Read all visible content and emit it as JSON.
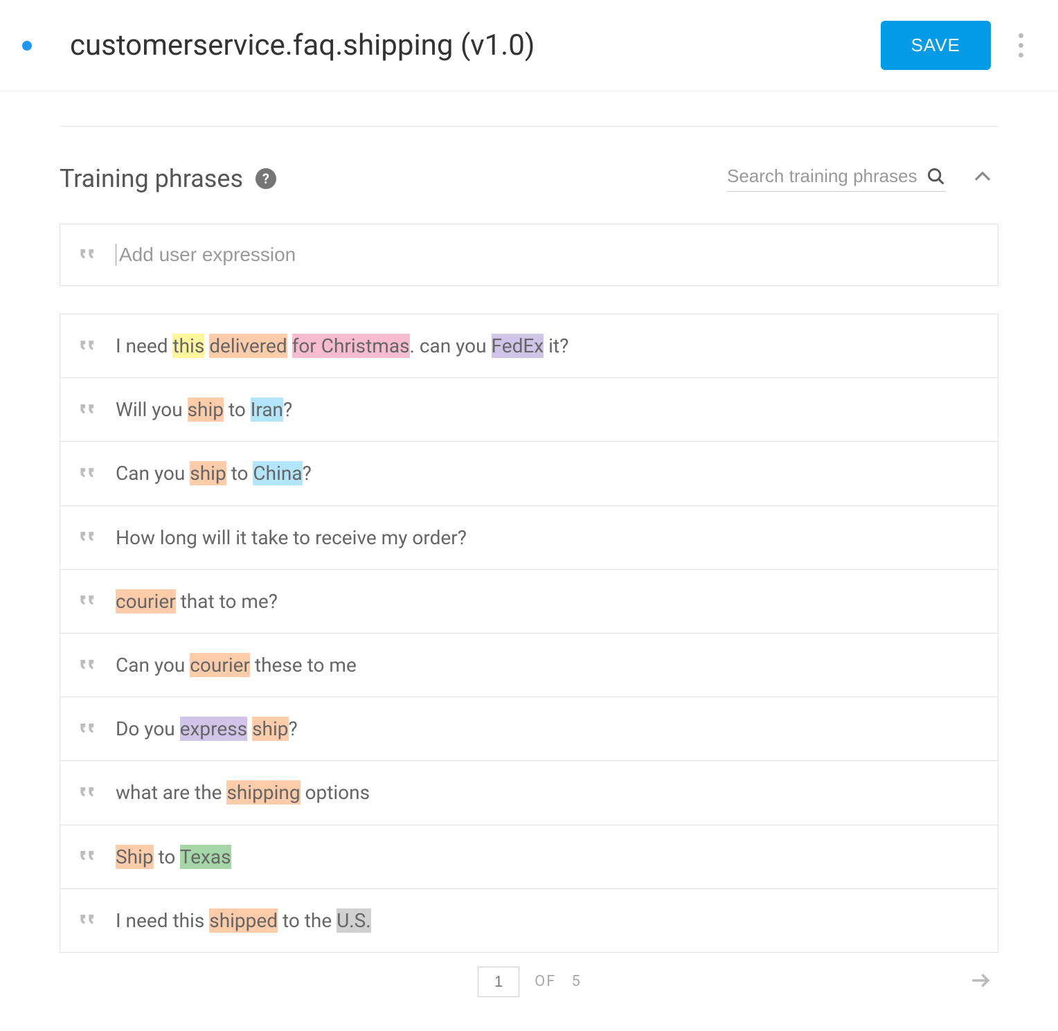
{
  "header": {
    "title": "customerservice.faq.shipping (v1.0)",
    "save_label": "SAVE"
  },
  "section": {
    "title": "Training phrases",
    "search_placeholder": "Search training phrases",
    "add_placeholder": "Add user expression"
  },
  "phrases": [
    {
      "tokens": [
        {
          "t": "I need "
        },
        {
          "t": "this",
          "c": "yellow"
        },
        {
          "t": " "
        },
        {
          "t": "delivered",
          "c": "orange"
        },
        {
          "t": " "
        },
        {
          "t": "for Christmas",
          "c": "pink"
        },
        {
          "t": ". can you "
        },
        {
          "t": "FedEx",
          "c": "purple"
        },
        {
          "t": " it?"
        }
      ]
    },
    {
      "tokens": [
        {
          "t": "Will you "
        },
        {
          "t": "ship",
          "c": "orange"
        },
        {
          "t": " to "
        },
        {
          "t": "Iran",
          "c": "cyan"
        },
        {
          "t": "?"
        }
      ]
    },
    {
      "tokens": [
        {
          "t": "Can you "
        },
        {
          "t": "ship",
          "c": "orange"
        },
        {
          "t": " to "
        },
        {
          "t": "China",
          "c": "cyan"
        },
        {
          "t": "?"
        }
      ]
    },
    {
      "tokens": [
        {
          "t": "How long will it take to receive my order?"
        }
      ]
    },
    {
      "tokens": [
        {
          "t": "courier",
          "c": "orange"
        },
        {
          "t": " that to me?"
        }
      ]
    },
    {
      "tokens": [
        {
          "t": "Can you "
        },
        {
          "t": "courier",
          "c": "orange"
        },
        {
          "t": " these to me"
        }
      ]
    },
    {
      "tokens": [
        {
          "t": "Do you "
        },
        {
          "t": "express",
          "c": "purple"
        },
        {
          "t": " "
        },
        {
          "t": "ship",
          "c": "orange"
        },
        {
          "t": "?"
        }
      ]
    },
    {
      "tokens": [
        {
          "t": "what are the "
        },
        {
          "t": "shipping",
          "c": "orange"
        },
        {
          "t": " options"
        }
      ]
    },
    {
      "tokens": [
        {
          "t": "Ship",
          "c": "orange"
        },
        {
          "t": " to "
        },
        {
          "t": "Texas",
          "c": "green"
        }
      ]
    },
    {
      "tokens": [
        {
          "t": "I need this "
        },
        {
          "t": "shipped",
          "c": "orange"
        },
        {
          "t": " to the "
        },
        {
          "t": "U.S.",
          "c": "gray"
        }
      ]
    }
  ],
  "pagination": {
    "current": "1",
    "of_label": "OF",
    "total": "5"
  },
  "highlight_classes": {
    "yellow": "hl-yellow",
    "orange": "hl-orange",
    "pink": "hl-pink",
    "purple": "hl-purple",
    "cyan": "hl-cyan",
    "green": "hl-green",
    "gray": "hl-gray"
  }
}
